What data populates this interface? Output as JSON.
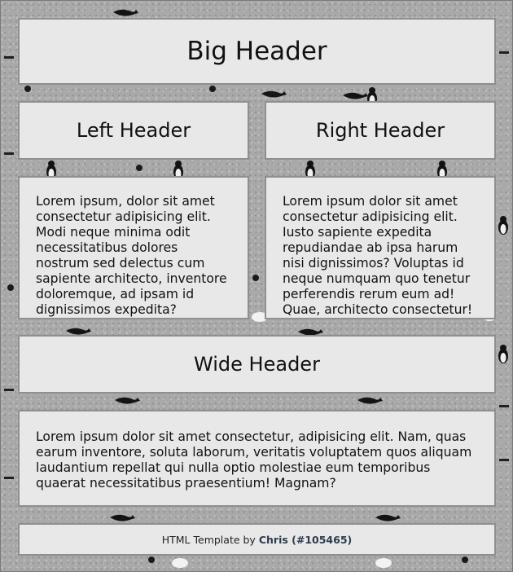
{
  "header": {
    "title": "Big Header"
  },
  "columns": {
    "left": {
      "title": "Left Header",
      "body": "Lorem ipsum, dolor sit amet consectetur adipisicing elit. Modi neque minima odit necessitatibus dolores nostrum sed delectus cum sapiente architecto, inventore doloremque, ad ipsam id dignissimos expedita?"
    },
    "right": {
      "title": "Right Header",
      "body": "Lorem ipsum dolor sit amet consectetur adipisicing elit. Iusto sapiente expedita repudiandae ab ipsa harum nisi dignissimos? Voluptas id neque numquam quo tenetur perferendis rerum eum ad! Quae, architecto consectetur!"
    }
  },
  "wide": {
    "title": "Wide Header",
    "body": "Lorem ipsum dolor sit amet consectetur, adipisicing elit. Nam, quas earum inventore, soluta laborum, veritatis voluptatem quos aliquam laudantium repellat qui nulla optio molestiae eum temporibus quaerat necessitatibus praesentium! Magnam?"
  },
  "footer": {
    "prefix": "HTML Template by",
    "author": "Chris (#105465)"
  },
  "colors": {
    "background": "#a9a9a9",
    "panel": "#e8e8e8",
    "panel_border": "#8f8f8f",
    "author_link": "#2d3b4c"
  },
  "icons": [
    "whale-icon",
    "penguin-icon",
    "polar-bear-icon",
    "seal-icon"
  ]
}
